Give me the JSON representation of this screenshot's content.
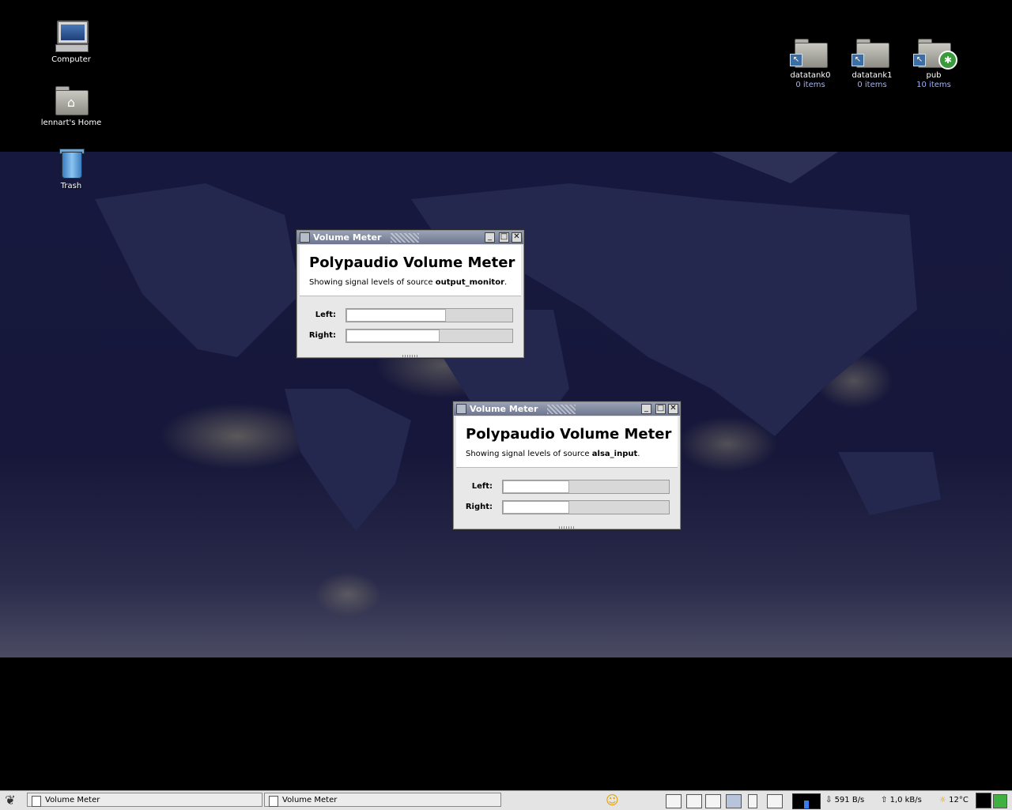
{
  "desktop": {
    "icons_left": [
      {
        "label": "Computer",
        "icon": "computer-icon"
      },
      {
        "label": "lennart's Home",
        "icon": "home-folder-icon"
      },
      {
        "label": "Trash",
        "icon": "trash-icon"
      }
    ],
    "icons_right": [
      {
        "label": "datatank0",
        "sub": "0 items",
        "icon": "folder-link-icon"
      },
      {
        "label": "datatank1",
        "sub": "0 items",
        "icon": "folder-link-icon"
      },
      {
        "label": "pub",
        "sub": "10 items",
        "icon": "shared-folder-icon"
      }
    ]
  },
  "windows": [
    {
      "title": "Volume Meter",
      "app_title": "Polypaudio Volume Meter",
      "desc_prefix": "Showing signal levels of source ",
      "source": "output_monitor",
      "desc_suffix": ".",
      "left_label": "Left:",
      "right_label": "Right:",
      "left_level": 0.6,
      "right_level": 0.56
    },
    {
      "title": "Volume Meter",
      "app_title": "Polypaudio Volume Meter",
      "desc_prefix": "Showing signal levels of source ",
      "source": "alsa_input",
      "desc_suffix": ".",
      "left_label": "Left:",
      "right_label": "Right:",
      "left_level": 0.4,
      "right_level": 0.4
    }
  ],
  "taskbar": {
    "tasks": [
      {
        "label": "Volume Meter"
      },
      {
        "label": "Volume Meter"
      }
    ],
    "net_in": "591 B/s",
    "net_out": "1,0 kB/s",
    "temperature": "12°C"
  },
  "colors": {
    "titlebar": "#7b8398",
    "wallpaper": "#17183e"
  }
}
